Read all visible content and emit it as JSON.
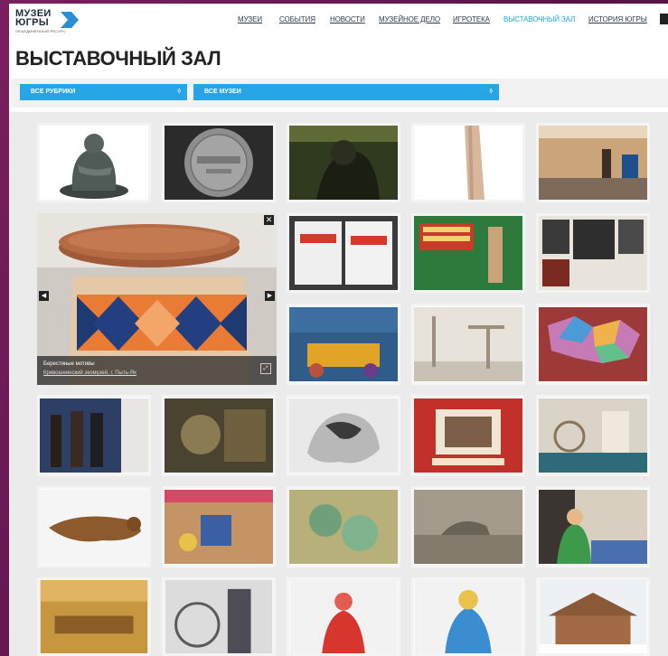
{
  "logo": {
    "line1": "МУЗЕИ",
    "line2": "ЮГРЫ",
    "sub": "ОБЪЕДИНЁННЫЙ РЕСУРС"
  },
  "nav": [
    {
      "label": "МУЗЕИ",
      "active": false
    },
    {
      "label": "СОБЫТИЯ",
      "active": false
    },
    {
      "label": "НОВОСТИ",
      "active": false
    },
    {
      "label": "МУЗЕЙНОЕ ДЕЛО",
      "active": false
    },
    {
      "label": "ИГРОТЕКА",
      "active": false
    },
    {
      "label": "ВЫСТАВОЧНЫЙ ЗАЛ",
      "active": true
    },
    {
      "label": "ИСТОРИЯ ЮГРЫ",
      "active": false
    }
  ],
  "page": {
    "title": "ВЫСТАВОЧНЫЙ ЗАЛ"
  },
  "filters": {
    "rubric": "ВСЕ РУБРИКИ",
    "museum": "ВСЕ МУЗЕИ",
    "arrow": "◊"
  },
  "featured": {
    "title": "Берестяные мотивы",
    "subtitle": "Кривошеинский экомузей, г. Пыть-Ях",
    "close": "✕",
    "prev": "◀",
    "next": "▶",
    "expand": "⤢"
  },
  "gallery_items": [
    {
      "name": "bronze-figure"
    },
    {
      "name": "coin"
    },
    {
      "name": "dark-sculpture"
    },
    {
      "name": "carved-wood"
    },
    {
      "name": "exhibit-room"
    },
    {
      "name": "posters"
    },
    {
      "name": "war-poster"
    },
    {
      "name": "war-photos"
    },
    {
      "name": "sacred-water-poster"
    },
    {
      "name": "workshop-tools"
    },
    {
      "name": "colored-map"
    },
    {
      "name": "visitors"
    },
    {
      "name": "medal-plaque"
    },
    {
      "name": "crumpled-figure"
    },
    {
      "name": "vintage-poster"
    },
    {
      "name": "spinning-wheel-room"
    },
    {
      "name": "stuffed-weasel"
    },
    {
      "name": "needlework"
    },
    {
      "name": "embroidery-green"
    },
    {
      "name": "sepia-photo"
    },
    {
      "name": "seated-woman"
    },
    {
      "name": "wooden-workshop"
    },
    {
      "name": "spinning-wheel"
    },
    {
      "name": "red-doll"
    },
    {
      "name": "folk-doll"
    },
    {
      "name": "wooden-house"
    }
  ],
  "theme": {
    "accent": "#27a5e6",
    "active_nav": "#1fa7e0",
    "background": "#5a1448"
  }
}
